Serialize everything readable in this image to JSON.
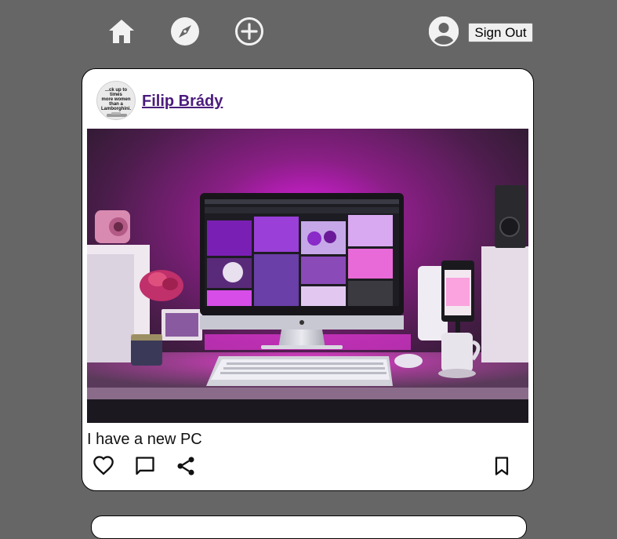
{
  "nav": {
    "home_icon": "home-icon",
    "explore_icon": "compass-icon",
    "create_icon": "add-circle-icon",
    "profile_icon": "account-circle-icon",
    "sign_out_label": "Sign Out"
  },
  "post": {
    "author": "Filip Brády",
    "avatar_text": [
      "...ck up to",
      "times",
      "more women",
      "than a",
      "Lamborghini."
    ],
    "caption": "I have a new PC",
    "actions": {
      "like_icon": "heart-icon",
      "comment_icon": "comment-icon",
      "share_icon": "share-icon",
      "save_icon": "bookmark-icon"
    }
  },
  "colors": {
    "background": "#666666",
    "card": "#ffffff",
    "author_link": "#4b1b7d",
    "nav_icon": "#f2f2f2"
  }
}
